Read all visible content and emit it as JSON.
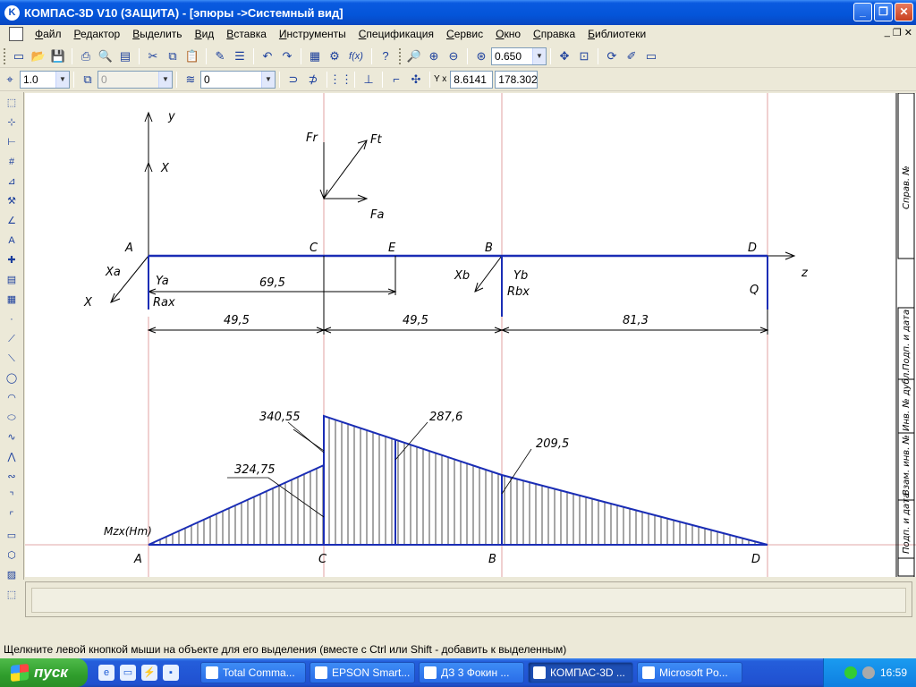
{
  "window": {
    "title": "КОМПАС-3D V10 (ЗАЩИТА) - [эпюры ->Системный вид]",
    "app_icon": "K"
  },
  "window_buttons": {
    "minimize": "_",
    "restore": "❐",
    "close": "✕"
  },
  "menu": {
    "items": [
      "Файл",
      "Редактор",
      "Выделить",
      "Вид",
      "Вставка",
      "Инструменты",
      "Спецификация",
      "Сервис",
      "Окно",
      "Справка",
      "Библиотеки"
    ]
  },
  "toolbar1": {
    "zoom_value": "0.650",
    "fx_label": "f(x)"
  },
  "toolbar2": {
    "line_scale": "1.0",
    "style_value": "0",
    "layer_value": "0",
    "coord_x": "8.6141",
    "coord_y": "178.302",
    "coord_label": "Y x"
  },
  "drawing": {
    "labels": {
      "y_axis": "y",
      "x_upper": "X",
      "x_lower": "X",
      "z_axis": "z",
      "A": "A",
      "C": "C",
      "E": "E",
      "B": "B",
      "D": "D",
      "Fr": "Fr",
      "Ft": "Ft",
      "Fa": "Fa",
      "Xa": "Xa",
      "Ya": "Ya",
      "Rax": "Rax",
      "Xb": "Xb",
      "Yb": "Yb",
      "Rbx": "Rbx",
      "Q": "Q"
    },
    "dimensions": {
      "AE": "69,5",
      "AC": "49,5",
      "CB": "49,5",
      "BD": "81,3"
    },
    "moment": {
      "axis_label": "Mzx(Hm)",
      "values": {
        "C_left": "324,75",
        "C_right": "340,55",
        "E": "287,6",
        "B": "209,5"
      },
      "bottom_labels": [
        "A",
        "C",
        "B",
        "D"
      ]
    },
    "stamp": {
      "labels": [
        "Справ. №",
        "Подп. и дата",
        "Инв. № дубл.",
        "Взам. инв. №",
        "Подп. и дата"
      ]
    }
  },
  "statusbar": {
    "text": "Щелкните левой кнопкой мыши на объекте для его выделения (вместе с Ctrl или Shift - добавить к выделенным)"
  },
  "taskbar": {
    "start_label": "пуск",
    "tasks": [
      "Total Comma...",
      "EPSON Smart...",
      "ДЗ 3 Фокин ...",
      "КОМПАС-3D ...",
      "Microsoft Po..."
    ],
    "clock": "16:59"
  },
  "colors": {
    "outline": "#1a2db5",
    "guide": "#d98a8a",
    "titlebar": "#0455d9",
    "taskbar": "#245edb"
  }
}
